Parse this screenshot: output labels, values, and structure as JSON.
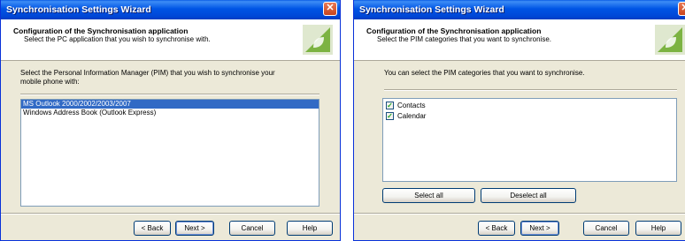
{
  "wizard1": {
    "title": "Synchronisation Settings Wizard",
    "header_title": "Configuration of the Synchronisation application",
    "header_subtitle": "Select the PC application that you wish to synchronise with.",
    "prompt_line1": "Select the Personal Information Manager (PIM) that you wish to synchronise your",
    "prompt_line2": "mobile phone with:",
    "applications": [
      {
        "label": "MS Outlook 2000/2002/2003/2007",
        "selected": true
      },
      {
        "label": "Windows Address Book (Outlook Express)",
        "selected": false
      }
    ],
    "buttons": {
      "back": "< Back",
      "next": "Next >",
      "cancel": "Cancel",
      "help": "Help"
    }
  },
  "wizard2": {
    "title": "Synchronisation Settings Wizard",
    "header_title": "Configuration of the Synchronisation application",
    "header_subtitle": "Select the PIM categories that you want to synchronise.",
    "prompt": "You can select the PIM categories that you want to synchronise.",
    "categories": [
      {
        "label": "Contacts",
        "checked": true
      },
      {
        "label": "Calendar",
        "checked": true
      }
    ],
    "select_all": "Select all",
    "deselect_all": "Deselect all",
    "buttons": {
      "back": "< Back",
      "next": "Next >",
      "cancel": "Cancel",
      "help": "Help"
    }
  },
  "icons": {
    "close": "close-icon",
    "logo": "android-logo-icon",
    "check": "checkmark-icon"
  },
  "colors": {
    "titlebar": "#0055e5",
    "selection": "#316ac5",
    "logo_green": "#8bc34a",
    "dialog_bg": "#ece9d8"
  }
}
